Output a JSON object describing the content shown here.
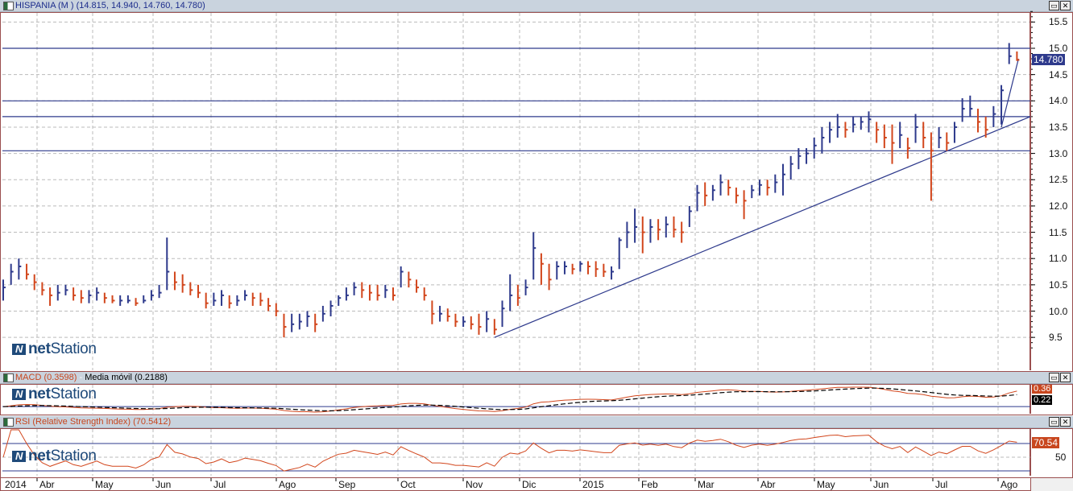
{
  "main": {
    "title": "HISPANIA (M ) (14.815, 14.940, 14.760, 14.780)",
    "last_price_label": "14.780",
    "logo": "netStation"
  },
  "macd": {
    "title_macd": "MACD (0.3598)",
    "title_sep": " - ",
    "title_signal": "Media móvil (0.2188)",
    "macd_label": "0.36",
    "signal_label": "0.22",
    "logo": "netStation"
  },
  "rsi": {
    "title": "RSI (Relative Strength Index) (70.5412)",
    "value_label": "70.54",
    "level_label": "50",
    "logo": "netStation"
  },
  "window_buttons": {
    "maximize": "▭",
    "close": "✕"
  },
  "colors": {
    "up": "#2e3a8c",
    "down": "#d2461c",
    "border": "#9b4f4f",
    "line": "#2e3a8c",
    "signal": "#000000"
  },
  "chart_data": {
    "type": "ohlc",
    "title": "HISPANIA (M )",
    "ylim": [
      9.2,
      15.7
    ],
    "yticks": [
      "9.5",
      "10.0",
      "10.5",
      "11.0",
      "11.5",
      "12.0",
      "12.5",
      "13.0",
      "13.5",
      "14.0",
      "14.5",
      "15.0",
      "15.5"
    ],
    "xticks": [
      "2014",
      "Abr",
      "May",
      "Jun",
      "Jul",
      "Ago",
      "Sep",
      "Oct",
      "Nov",
      "Dic",
      "2015",
      "Feb",
      "Mar",
      "Abr",
      "May",
      "Jun",
      "Jul",
      "Ago"
    ],
    "grid": true,
    "close": [
      10.45,
      10.75,
      10.85,
      10.7,
      10.55,
      10.4,
      10.3,
      10.35,
      10.4,
      10.3,
      10.25,
      10.3,
      10.35,
      10.25,
      10.2,
      10.2,
      10.2,
      10.15,
      10.2,
      10.3,
      10.35,
      10.75,
      10.55,
      10.5,
      10.4,
      10.35,
      10.15,
      10.2,
      10.3,
      10.15,
      10.2,
      10.3,
      10.25,
      10.2,
      10.1,
      10.0,
      9.7,
      9.75,
      9.8,
      9.9,
      9.75,
      9.95,
      10.1,
      10.25,
      10.3,
      10.45,
      10.4,
      10.35,
      10.3,
      10.4,
      10.3,
      10.75,
      10.6,
      10.45,
      10.3,
      9.95,
      9.95,
      9.9,
      9.8,
      9.8,
      9.75,
      9.7,
      9.85,
      9.65,
      10.05,
      10.3,
      10.25,
      10.45,
      11.2,
      10.9,
      10.6,
      10.85,
      10.85,
      10.8,
      10.9,
      10.85,
      10.8,
      10.75,
      10.75,
      11.35,
      11.5,
      11.6,
      11.5,
      11.6,
      11.55,
      11.65,
      11.55,
      11.5,
      11.9,
      12.25,
      12.2,
      12.3,
      12.45,
      12.35,
      12.2,
      12.1,
      12.3,
      12.4,
      12.35,
      12.45,
      12.6,
      12.8,
      12.95,
      13.0,
      13.15,
      13.3,
      13.45,
      13.5,
      13.45,
      13.55,
      13.6,
      13.65,
      13.45,
      13.3,
      13.2,
      13.35,
      13.1,
      13.5,
      13.3,
      13.05,
      13.3,
      13.2,
      13.5,
      13.85,
      13.85,
      13.6,
      13.45,
      13.75,
      14.2,
      14.85,
      14.78
    ],
    "high": [
      10.6,
      10.9,
      11.0,
      10.9,
      10.7,
      10.55,
      10.45,
      10.5,
      10.5,
      10.45,
      10.4,
      10.4,
      10.45,
      10.35,
      10.3,
      10.3,
      10.3,
      10.25,
      10.3,
      10.4,
      10.5,
      11.4,
      10.75,
      10.7,
      10.55,
      10.5,
      10.35,
      10.35,
      10.4,
      10.3,
      10.3,
      10.4,
      10.35,
      10.35,
      10.25,
      10.15,
      9.95,
      9.95,
      9.95,
      10.0,
      9.95,
      10.1,
      10.2,
      10.3,
      10.45,
      10.55,
      10.55,
      10.5,
      10.5,
      10.5,
      10.45,
      10.85,
      10.75,
      10.6,
      10.45,
      10.2,
      10.1,
      10.05,
      9.95,
      9.9,
      9.9,
      9.95,
      10.0,
      9.85,
      10.2,
      10.7,
      10.5,
      10.6,
      11.5,
      11.1,
      10.9,
      10.95,
      10.95,
      10.9,
      10.95,
      10.95,
      10.95,
      10.9,
      10.85,
      11.4,
      11.7,
      11.95,
      11.8,
      11.75,
      11.75,
      11.8,
      11.8,
      11.7,
      12.0,
      12.4,
      12.45,
      12.4,
      12.6,
      12.5,
      12.35,
      12.3,
      12.4,
      12.5,
      12.5,
      12.6,
      12.8,
      12.95,
      13.1,
      13.1,
      13.3,
      13.5,
      13.6,
      13.75,
      13.6,
      13.7,
      13.7,
      13.8,
      13.6,
      13.55,
      13.55,
      13.6,
      13.3,
      13.75,
      13.6,
      13.4,
      13.5,
      13.4,
      13.6,
      14.05,
      14.1,
      13.85,
      13.7,
      13.9,
      14.3,
      15.1,
      14.94
    ],
    "low": [
      10.2,
      10.5,
      10.6,
      10.6,
      10.4,
      10.3,
      10.1,
      10.2,
      10.3,
      10.2,
      10.15,
      10.15,
      10.2,
      10.15,
      10.15,
      10.1,
      10.15,
      10.1,
      10.15,
      10.2,
      10.25,
      10.4,
      10.4,
      10.35,
      10.3,
      10.25,
      10.05,
      10.1,
      10.1,
      10.05,
      10.1,
      10.2,
      10.1,
      10.1,
      10.0,
      9.9,
      9.5,
      9.6,
      9.65,
      9.7,
      9.6,
      9.8,
      9.9,
      10.1,
      10.2,
      10.3,
      10.25,
      10.2,
      10.2,
      10.25,
      10.2,
      10.45,
      10.45,
      10.35,
      10.2,
      9.75,
      9.8,
      9.8,
      9.7,
      9.7,
      9.65,
      9.55,
      9.6,
      9.55,
      9.7,
      10.0,
      10.1,
      10.3,
      10.6,
      10.5,
      10.4,
      10.6,
      10.7,
      10.7,
      10.75,
      10.7,
      10.65,
      10.65,
      10.6,
      10.8,
      11.2,
      11.3,
      11.1,
      11.3,
      11.35,
      11.4,
      11.4,
      11.3,
      11.6,
      11.9,
      12.0,
      12.1,
      12.2,
      12.2,
      12.05,
      11.75,
      12.15,
      12.2,
      12.2,
      12.25,
      12.2,
      12.5,
      12.7,
      12.8,
      12.9,
      13.0,
      13.2,
      13.3,
      13.3,
      13.4,
      13.45,
      13.4,
      13.2,
      13.1,
      12.8,
      13.1,
      12.9,
      13.2,
      13.1,
      12.1,
      13.1,
      13.05,
      13.2,
      13.6,
      13.7,
      13.4,
      13.3,
      13.5,
      13.55,
      14.7,
      14.76
    ],
    "horizontal_levels": [
      15.0,
      14.0,
      13.7,
      13.05
    ],
    "trendlines": [
      {
        "from_bar": 63,
        "from_price": 9.5,
        "to_bar": 132,
        "to_price": 13.7
      },
      {
        "from_bar": 128,
        "from_price": 13.5,
        "to_bar": 130.2,
        "to_price": 14.8
      }
    ],
    "indicators": {
      "macd": {
        "fast": 12,
        "slow": 26,
        "signal": 9,
        "last_macd": 0.3598,
        "last_signal": 0.2188
      },
      "rsi": {
        "period": 14,
        "last": 70.5412,
        "levels": [
          30,
          50,
          70
        ]
      }
    }
  }
}
